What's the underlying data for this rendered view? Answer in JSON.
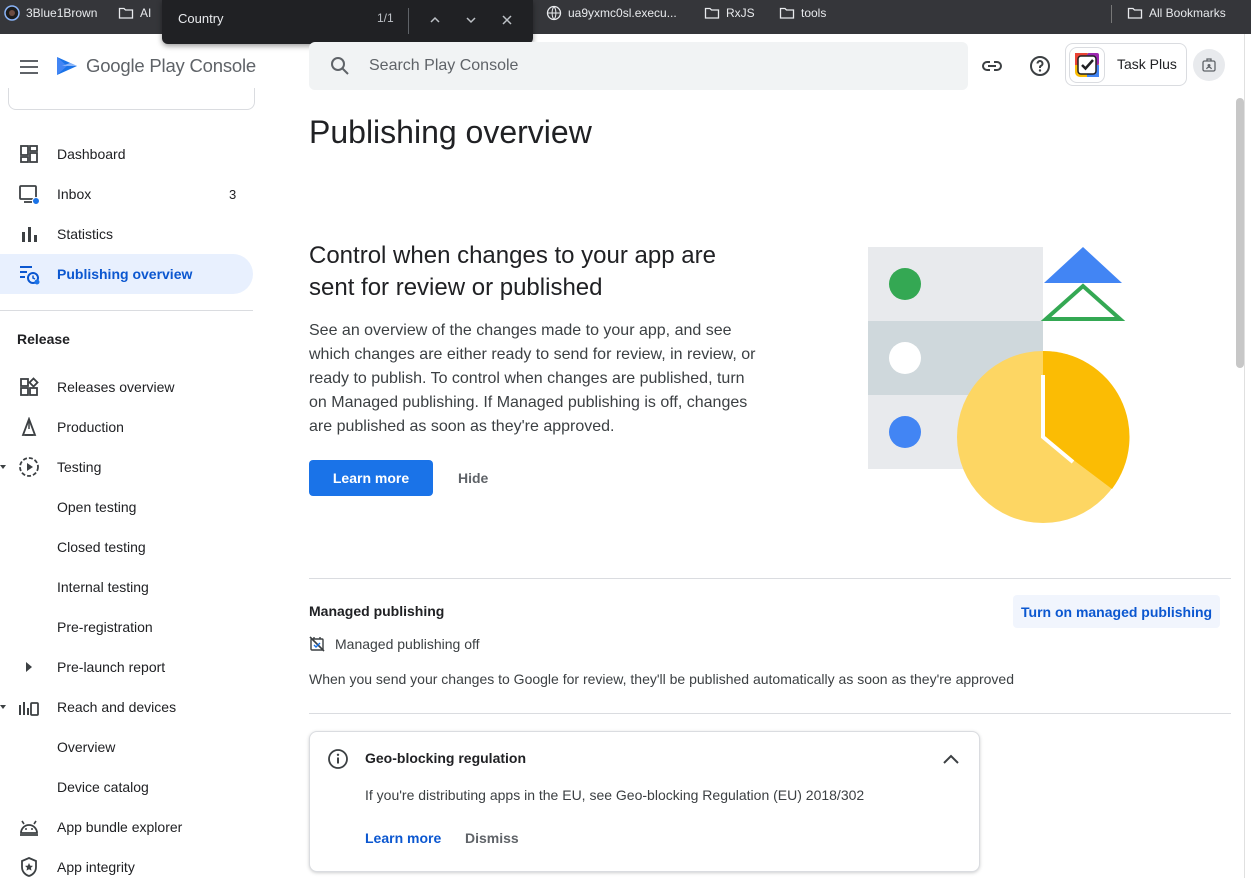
{
  "browser": {
    "bookmarks": [
      {
        "label": "3Blue1Brown",
        "icon": "site-favicon"
      },
      {
        "label": "AI",
        "icon": "folder-icon"
      },
      {
        "label": "ua9yxmc0sl.execu...",
        "icon": "globe-icon"
      },
      {
        "label": "RxJS",
        "icon": "folder-icon"
      },
      {
        "label": "tools",
        "icon": "folder-icon"
      },
      {
        "label": "All Bookmarks",
        "icon": "folder-icon"
      }
    ],
    "find_bar": {
      "query": "Country",
      "count": "1/1"
    }
  },
  "header": {
    "logo_text": "Google Play Console",
    "search_placeholder": "Search Play Console",
    "app_name": "Task Plus"
  },
  "sidebar": {
    "items": [
      {
        "label": "Dashboard",
        "icon": "dashboard-icon"
      },
      {
        "label": "Inbox",
        "icon": "inbox-icon",
        "badge": "3"
      },
      {
        "label": "Statistics",
        "icon": "bar-chart-icon"
      },
      {
        "label": "Publishing overview",
        "icon": "publishing-icon",
        "active": true
      }
    ],
    "release_section": "Release",
    "release_items": [
      {
        "label": "Releases overview",
        "icon": "releases-icon"
      },
      {
        "label": "Production",
        "icon": "production-icon"
      },
      {
        "label": "Testing",
        "icon": "testing-icon"
      },
      {
        "label": "Open testing"
      },
      {
        "label": "Closed testing"
      },
      {
        "label": "Internal testing"
      },
      {
        "label": "Pre-registration"
      },
      {
        "label": "Pre-launch report"
      },
      {
        "label": "Reach and devices",
        "icon": "reach-icon"
      },
      {
        "label": "Overview"
      },
      {
        "label": "Device catalog"
      },
      {
        "label": "App bundle explorer",
        "icon": "android-icon"
      },
      {
        "label": "App integrity",
        "icon": "shield-icon"
      }
    ]
  },
  "main": {
    "page_title": "Publishing overview",
    "hero": {
      "title": "Control when changes to your app are sent for review or published",
      "description": "See an overview of the changes made to your app, and see which changes are either ready to send for review, in review, or ready to publish. To control when changes are published, turn on Managed publishing. If Managed publishing is off, changes are published as soon as they're approved.",
      "learn_more": "Learn more",
      "hide": "Hide"
    },
    "managed_publishing": {
      "title": "Managed publishing",
      "action": "Turn on managed publishing",
      "status": "Managed publishing off",
      "description": "When you send your changes to Google for review, they'll be published automatically as soon as they're approved"
    },
    "geo_card": {
      "title": "Geo-blocking regulation",
      "description": "If you're distributing apps in the EU, see Geo-blocking Regulation (EU) 2018/302",
      "learn_more": "Learn more",
      "dismiss": "Dismiss"
    }
  },
  "colors": {
    "accent": "#1a73e8",
    "active_bg": "#e8f0fe",
    "active_text": "#0b57d0",
    "illus_green": "#34a853",
    "illus_blue": "#4285f4",
    "illus_yellow": "#fdd663",
    "illus_orange": "#fbbc04"
  }
}
